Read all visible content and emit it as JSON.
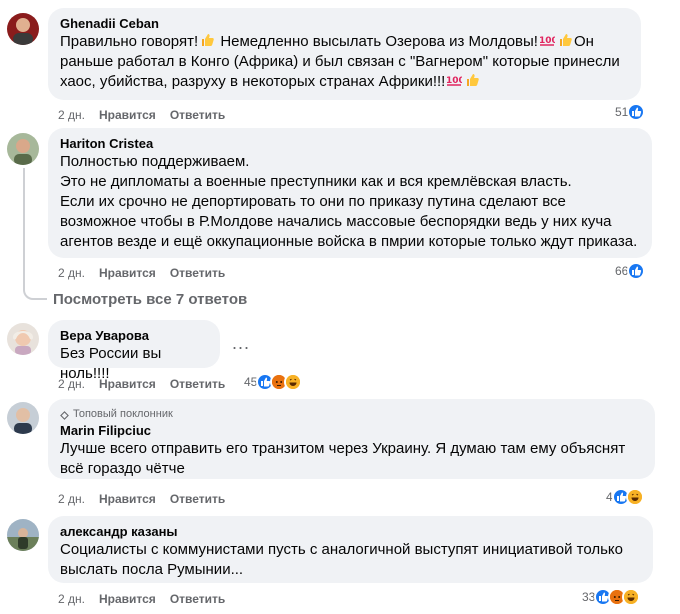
{
  "comments": [
    {
      "author": "Ghenadii Ceban",
      "lines": [
        "Правильно говорят!",
        "Немедленно высылать Озерова из Молдовы!",
        "Он",
        "раньше работал в Конго (Африка) и был связан с \"Вагнером\" которые принесли",
        "хаос, убийства, разруху в некоторых странах Африки!!!"
      ],
      "time": "2 дн.",
      "like_label": "Нравится",
      "reply_label": "Ответить",
      "reaction_count": "51",
      "reactions": [
        "like"
      ]
    },
    {
      "author": "Hariton Cristea",
      "text": "Полностью поддерживаем.\nЭто не дипломаты а военные преступники как и вся кремлёвская власть.\nЕсли их срочно не депортировать то они по приказу путина сделают все\nвозможное чтобы в Р.Молдове начались массовые беспорядки ведь у них куча\nагентов везде и ещё оккупационные войска в пмрии которые только ждут приказа.",
      "time": "2 дн.",
      "like_label": "Нравится",
      "reply_label": "Ответить",
      "reaction_count": "66",
      "reactions": [
        "like"
      ]
    },
    {
      "author": "Вера Уварова",
      "text": "Без России вы ноль!!!!",
      "time": "2 дн.",
      "like_label": "Нравится",
      "reply_label": "Ответить",
      "reaction_count": "45",
      "reactions": [
        "like",
        "angry",
        "haha"
      ]
    },
    {
      "badge": "Топовый поклонник",
      "author": "Marin Filipciuc",
      "text": "Лучше всего отправить его транзитом через Украину. Я думаю там ему объяснят\nвсё гораздо чётче",
      "time": "2 дн.",
      "like_label": "Нравится",
      "reply_label": "Ответить",
      "reaction_count": "4",
      "reactions": [
        "like",
        "haha"
      ]
    },
    {
      "author": "александр казаны",
      "text": "Социалисты с коммунистами пусть с аналогичной выступят инициативой только\nвыслать посла Румынии...",
      "time": "2 дн.",
      "like_label": "Нравится",
      "reply_label": "Ответить",
      "reaction_count": "33",
      "reactions": [
        "like",
        "angry",
        "haha"
      ]
    }
  ],
  "view_replies": "Посмотреть все 7 ответов",
  "more_options": "...",
  "icons": {
    "like": "like-reaction-icon",
    "angry": "angry-reaction-icon",
    "haha": "haha-reaction-icon",
    "thumbs_up_emoji": "thumbs-up-emoji",
    "hundred_emoji": "hundred-points-emoji",
    "badge": "diamond-badge-icon"
  },
  "colors": {
    "bubble": "#f0f2f5",
    "like_blue": "#1877f2",
    "angry": "#e9710f",
    "haha": "#f7b125",
    "secondary_text": "#65676b"
  }
}
